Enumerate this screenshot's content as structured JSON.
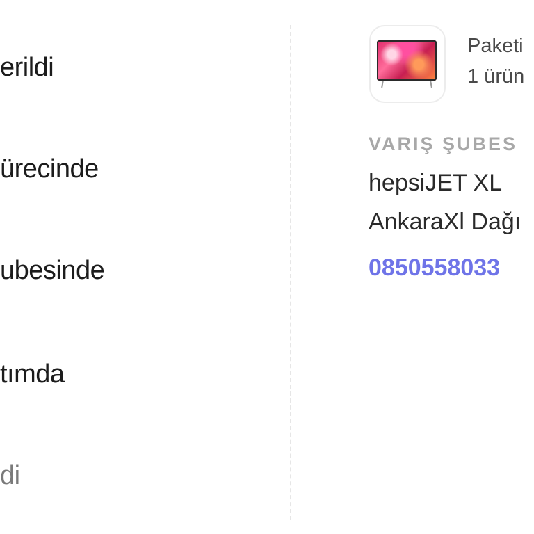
{
  "tracking_steps": [
    {
      "label": "erildi",
      "state": "done"
    },
    {
      "label": "ürecinde",
      "state": "done"
    },
    {
      "label": "ubesinde",
      "state": "done"
    },
    {
      "label": "tımda",
      "state": "done"
    },
    {
      "label": "di",
      "state": "pending"
    }
  ],
  "package": {
    "image_icon": "tv-product-thumbnail",
    "title": "Paketi",
    "count": "1 ürün"
  },
  "branch": {
    "label": "VARIŞ ŞUBES",
    "name": "hepsiJET XL",
    "address": "AnkaraXl Dağı",
    "phone": "0850558033"
  },
  "colors": {
    "text_primary": "#1c1c1c",
    "text_muted": "#7a7a7a",
    "label_gray": "#a8a8a8",
    "phone_link": "#6f74e8",
    "divider": "#e6e6e6"
  }
}
